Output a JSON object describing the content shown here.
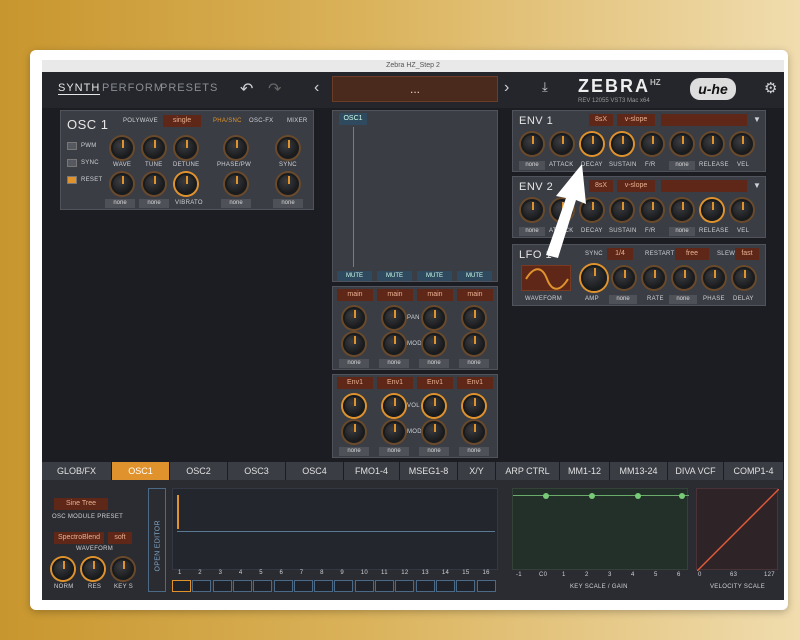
{
  "window_title": "Zebra HZ_Step 2",
  "nav": {
    "synth": "SYNTH",
    "perform": "PERFORM",
    "presets": "PRESETS"
  },
  "preset_name": "...",
  "logo": {
    "name": "ZEBRA",
    "sup": "HZ",
    "rev": "REV 12055  VST3  Mac x64",
    "uhe": "u-he"
  },
  "osc1": {
    "title": "OSC 1",
    "polywave_label": "POLYWAVE",
    "polywave_value": "single",
    "tabs": [
      "PHA/SNC",
      "OSC-FX",
      "MIXER"
    ],
    "switches": [
      "PWM",
      "SYNC",
      "RESET"
    ],
    "knobs_row1": [
      "WAVE",
      "TUNE",
      "DETUNE"
    ],
    "phase_pw": "PHASE/PW",
    "sync": "SYNC",
    "vibrato": "VIBRATO",
    "none": "none"
  },
  "mixer": {
    "osc_label": "OSC1",
    "mute": "MUTE",
    "main": "main",
    "pan": "PAN",
    "mod": "MOD",
    "env": "Env1",
    "vol": "VOL",
    "none": "none"
  },
  "env1": {
    "title": "ENV 1",
    "mode": "8sX",
    "slope": "v-slope",
    "labels": [
      "ATTACK",
      "DECAY",
      "SUSTAIN",
      "F/R",
      "RELEASE",
      "VEL"
    ],
    "none": "none"
  },
  "env2": {
    "title": "ENV 2",
    "mode": "8sX",
    "slope": "v-slope",
    "labels": [
      "ATTACK",
      "DECAY",
      "SUSTAIN",
      "F/R",
      "RELEASE",
      "VEL"
    ],
    "none": "none"
  },
  "lfo1": {
    "title": "LFO 1",
    "sync_label": "SYNC",
    "sync_value": "1/4",
    "restart_label": "RESTART",
    "restart_value": "free",
    "slew_label": "SLEW",
    "slew_value": "fast",
    "labels": [
      "WAVEFORM",
      "AMP",
      "RATE",
      "PHASE",
      "DELAY"
    ],
    "none": "none"
  },
  "tabs": [
    "GLOB/FX",
    "OSC1",
    "OSC2",
    "OSC3",
    "OSC4",
    "FMO1-4",
    "MSEG1-8",
    "X/Y",
    "ARP CTRL",
    "MM1-12",
    "MM13-24",
    "DIVA VCF",
    "COMP1-4"
  ],
  "bottom": {
    "module_preset_value": "Sine Tree",
    "module_preset_label": "OSC MODULE PRESET",
    "waveform_value": "SpectroBlend",
    "waveform_mode": "soft",
    "waveform_label": "WAVEFORM",
    "knobs": [
      "NORM",
      "RES",
      "KEY S"
    ],
    "open_editor": "OPEN EDITOR",
    "steps": [
      "1",
      "2",
      "3",
      "4",
      "5",
      "6",
      "7",
      "8",
      "9",
      "10",
      "11",
      "12",
      "13",
      "14",
      "15",
      "16"
    ],
    "keyscale_ticks": [
      "-1",
      "C0",
      "1",
      "2",
      "3",
      "4",
      "5",
      "6"
    ],
    "keyscale_label": "KEY SCALE / GAIN",
    "velocity_ticks": [
      "0",
      "63",
      "127"
    ],
    "velocity_label": "VELOCITY SCALE"
  },
  "colors": {
    "accent": "#e0932c",
    "preset_bg": "#4a2a1c"
  }
}
